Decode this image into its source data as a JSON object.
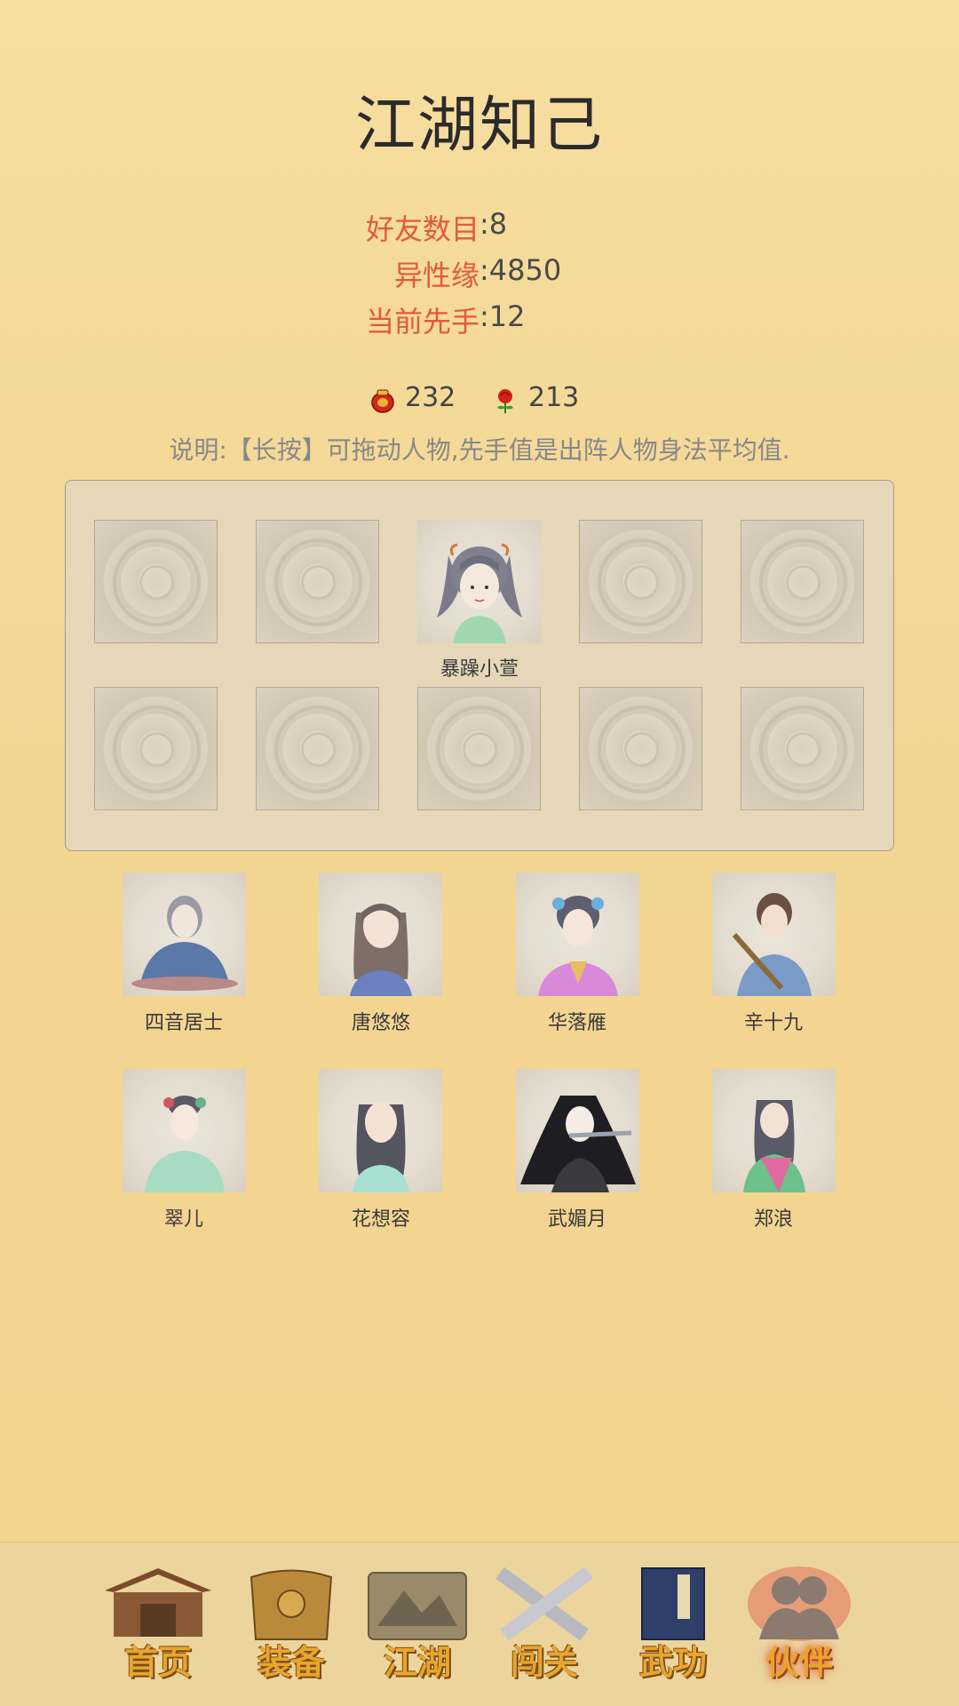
{
  "page": {
    "title": "江湖知己"
  },
  "stats": [
    {
      "label": "好友数目",
      "value": ":8"
    },
    {
      "label": "异性缘",
      "value": ":4850"
    },
    {
      "label": "当前先手",
      "value": ":12"
    }
  ],
  "resources": [
    {
      "icon": "red-jar-icon",
      "value": "232"
    },
    {
      "icon": "rose-icon",
      "value": "213"
    }
  ],
  "note": "说明:【长按】可拖动人物,先手值是出阵人物身法平均值.",
  "formation": {
    "occupied": {
      "slot": 3,
      "name": "暴躁小萱"
    }
  },
  "friends": [
    {
      "name": "四音居士"
    },
    {
      "name": "唐悠悠"
    },
    {
      "name": "华落雁"
    },
    {
      "name": "辛十九"
    },
    {
      "name": "翠儿"
    },
    {
      "name": "花想容"
    },
    {
      "name": "武媚月"
    },
    {
      "name": "郑浪"
    }
  ],
  "nav": [
    {
      "label": "首页",
      "icon": "house-icon"
    },
    {
      "label": "装备",
      "icon": "armor-icon"
    },
    {
      "label": "江湖",
      "icon": "scroll-map-icon"
    },
    {
      "label": "闯关",
      "icon": "crossed-swords-icon"
    },
    {
      "label": "武功",
      "icon": "book-icon"
    },
    {
      "label": "伙伴",
      "icon": "companions-icon",
      "active": true
    }
  ],
  "colors": {
    "accent": "#e25a3a",
    "background": "#f4d796",
    "board": "#e5d7b8"
  }
}
